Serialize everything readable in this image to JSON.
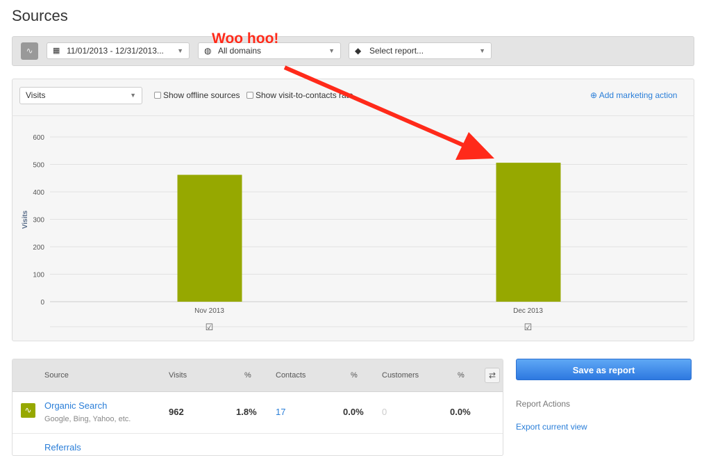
{
  "page_title": "Sources",
  "toolbar": {
    "date_range": "11/01/2013 - 12/31/2013...",
    "domain": "All domains",
    "report": "Select report..."
  },
  "annotation": {
    "text": "Woo hoo!",
    "color": "#ff2a1a"
  },
  "chart_controls": {
    "metric": "Visits",
    "offline_label": "Show offline sources",
    "rate_label": "Show visit-to-contacts rate",
    "add_action": "Add marketing action"
  },
  "chart_data": {
    "type": "bar",
    "categories": [
      "Nov 2013",
      "Dec 2013"
    ],
    "values": [
      462,
      506
    ],
    "ylabel": "Visits",
    "ylim": [
      0,
      600
    ],
    "yticks": [
      0,
      100,
      200,
      300,
      400,
      500,
      600
    ],
    "grid": true,
    "color": "#96a800"
  },
  "table": {
    "headers": [
      "Source",
      "Visits",
      "%",
      "Contacts",
      "%",
      "Customers",
      "%"
    ],
    "rows": [
      {
        "name": "Organic Search",
        "sub": "Google, Bing, Yahoo, etc.",
        "visits": "962",
        "visits_pct": "1.8%",
        "contacts": "17",
        "contacts_pct": "0.0%",
        "customers": "0",
        "customers_pct": "0.0%"
      },
      {
        "name": "Referrals"
      }
    ]
  },
  "side": {
    "save": "Save as report",
    "actions_title": "Report Actions",
    "export": "Export current view"
  }
}
